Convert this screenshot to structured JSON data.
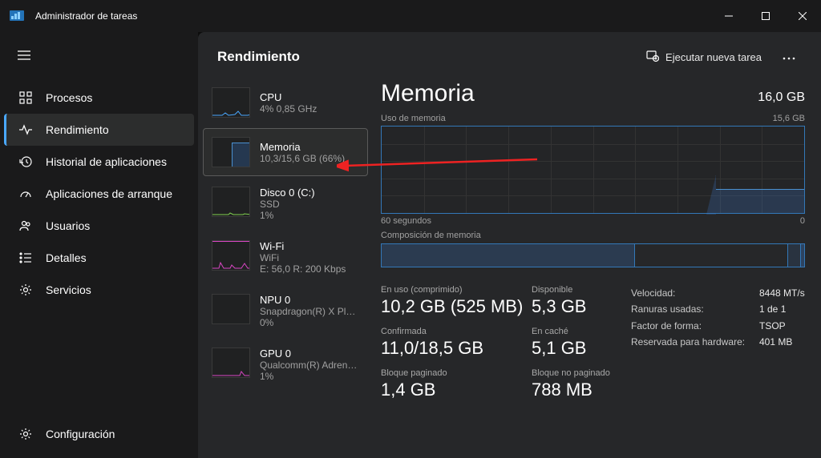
{
  "window": {
    "title": "Administrador de tareas"
  },
  "nav": [
    {
      "label": "Procesos"
    },
    {
      "label": "Rendimiento"
    },
    {
      "label": "Historial de aplicaciones"
    },
    {
      "label": "Aplicaciones de arranque"
    },
    {
      "label": "Usuarios"
    },
    {
      "label": "Detalles"
    },
    {
      "label": "Servicios"
    }
  ],
  "footer_nav": {
    "label": "Configuración"
  },
  "header": {
    "title": "Rendimiento",
    "action": "Ejecutar nueva tarea"
  },
  "perf_items": [
    {
      "name": "CPU",
      "stat": "4%  0,85 GHz"
    },
    {
      "name": "Memoria",
      "stat": "10,3/15,6 GB (66%)"
    },
    {
      "name": "Disco 0 (C:)",
      "stat1": "SSD",
      "stat2": "1%"
    },
    {
      "name": "Wi-Fi",
      "stat1": "WiFi",
      "stat2": "E: 56,0  R: 200 Kbps"
    },
    {
      "name": "NPU 0",
      "stat1": "Snapdragon(R) X Plus ...",
      "stat2": "0%"
    },
    {
      "name": "GPU 0",
      "stat1": "Qualcomm(R) Adreno...",
      "stat2": "1%"
    }
  ],
  "detail": {
    "title": "Memoria",
    "total": "16,0 GB",
    "usage_label": "Uso de memoria",
    "usage_max": "15,6 GB",
    "x_left": "60 segundos",
    "x_right": "0",
    "comp_label": "Composición de memoria",
    "stats": {
      "inuse_label": "En uso (comprimido)",
      "inuse_value": "10,2 GB (525 MB)",
      "avail_label": "Disponible",
      "avail_value": "5,3 GB",
      "commit_label": "Confirmada",
      "commit_value": "11,0/18,5 GB",
      "cache_label": "En caché",
      "cache_value": "5,1 GB",
      "paged_label": "Bloque paginado",
      "paged_value": "1,4 GB",
      "nonpaged_label": "Bloque no paginado",
      "nonpaged_value": "788 MB"
    },
    "kv": [
      {
        "k": "Velocidad:",
        "v": "8448 MT/s"
      },
      {
        "k": "Ranuras usadas:",
        "v": "1 de 1"
      },
      {
        "k": "Factor de forma:",
        "v": "TSOP"
      },
      {
        "k": "Reservada para hardware:",
        "v": "401 MB"
      }
    ]
  }
}
